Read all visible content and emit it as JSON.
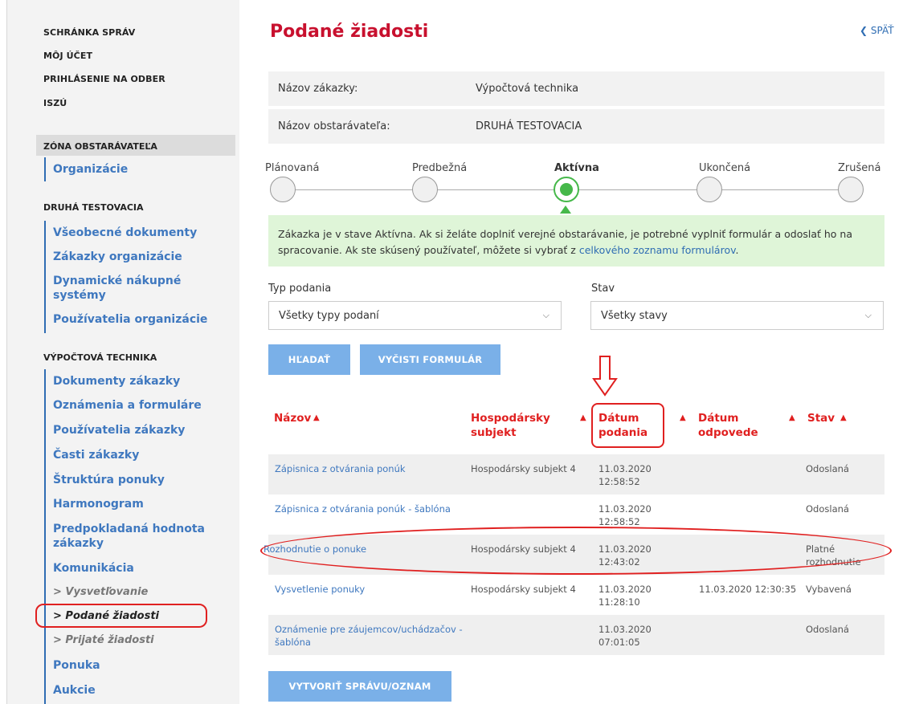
{
  "sidebar": {
    "top_links": [
      "SCHRÁNKA SPRÁV",
      "MÔJ ÚČET",
      "PRIHLÁSENIE NA ODBER",
      "ISZÚ"
    ],
    "zone_title": "ZÓNA OBSTARÁVATEĽA",
    "zone_items": [
      "Organizácie"
    ],
    "org_title": "DRUHÁ TESTOVACIA",
    "org_items": [
      "Všeobecné dokumenty",
      "Zákazky organizácie",
      "Dynamické nákupné systémy",
      "Používatelia organizácie"
    ],
    "contract_title": "VÝPOČTOVÁ TECHNIKA",
    "contract_items": [
      "Dokumenty zákazky",
      "Oznámenia a formuláre",
      "Používatelia zákazky",
      "Časti zákazky",
      "Štruktúra ponuky",
      "Harmonogram",
      "Predpokladaná hodnota zákazky",
      "Komunikácia"
    ],
    "sub_items": [
      "> Vysvetľovanie",
      "> Podané žiadosti",
      "> Prijaté žiadosti"
    ],
    "bottom_items": [
      "Ponuka",
      "Aukcie"
    ]
  },
  "header": {
    "title": "Podané žiadosti",
    "back_label": "SPÄŤ"
  },
  "info": {
    "contract_label": "Názov zákazky:",
    "contract_value": "Výpočtová technika",
    "buyer_label": "Názov obstarávateľa:",
    "buyer_value": "DRUHÁ TESTOVACIA"
  },
  "stepper": {
    "steps": [
      "Plánovaná",
      "Predbežná",
      "Aktívna",
      "Ukončená",
      "Zrušená"
    ],
    "active_index": 2
  },
  "notice": {
    "text": "Zákazka je v stave Aktívna. Ak si želáte doplniť verejné obstarávanie, je potrebné vyplniť formulár a odoslať ho na spracovanie. Ak ste skúsený používateľ, môžete si vybrať z ",
    "link": "celkového zoznamu formulárov",
    "end": "."
  },
  "filters": {
    "type_label": "Typ podania",
    "type_value": "Všetky typy podaní",
    "status_label": "Stav",
    "status_value": "Všetky stavy"
  },
  "buttons": {
    "search": "HĽADAŤ",
    "clear": "VYČISTI FORMULÁR",
    "create": "VYTVORIŤ SPRÁVU/OZNAM"
  },
  "table": {
    "headers": [
      "Názov",
      "Hospodársky subjekt",
      "Dátum podania",
      "Dátum odpovede",
      "Stav"
    ],
    "rows": [
      {
        "name": "Zápisnica z otvárania ponúk",
        "subject": "Hospodársky subjekt 4",
        "submitted": "11.03.2020 12:58:52",
        "answered": "",
        "status": "Odoslaná"
      },
      {
        "name": "Zápisnica z otvárania ponúk - šablóna",
        "subject": "",
        "submitted": "11.03.2020 12:58:52",
        "answered": "",
        "status": "Odoslaná"
      },
      {
        "name": "Rozhodnutie o ponuke",
        "subject": "Hospodársky subjekt 4",
        "submitted": "11.03.2020 12:43:02",
        "answered": "",
        "status": "Platné rozhodnutie"
      },
      {
        "name": "Vysvetlenie ponuky",
        "subject": "Hospodársky subjekt 4",
        "submitted": "11.03.2020 11:28:10",
        "answered": "11.03.2020 12:30:35",
        "status": "Vybavená"
      },
      {
        "name": "Oznámenie pre záujemcov/uchádzačov - šablóna",
        "subject": "",
        "submitted": "11.03.2020 07:01:05",
        "answered": "",
        "status": "Odoslaná"
      }
    ]
  },
  "colors": {
    "accent_red": "#c8102e",
    "link_blue": "#3f78bf",
    "button_blue": "#7ab0e8",
    "success_green": "#46b84a",
    "notice_bg": "#dff5d8",
    "annotation_red": "#e02020"
  }
}
